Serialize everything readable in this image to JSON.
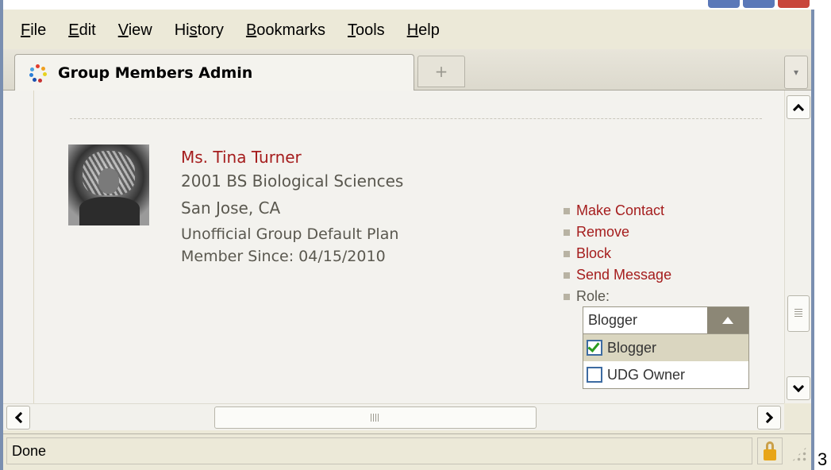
{
  "menubar": {
    "items": [
      {
        "name": "file",
        "prefix": "",
        "accel": "F",
        "rest": "ile"
      },
      {
        "name": "edit",
        "prefix": "",
        "accel": "E",
        "rest": "dit"
      },
      {
        "name": "view",
        "prefix": "",
        "accel": "V",
        "rest": "iew"
      },
      {
        "name": "history",
        "prefix": "Hi",
        "accel": "s",
        "rest": "tory"
      },
      {
        "name": "bookmarks",
        "prefix": "",
        "accel": "B",
        "rest": "ookmarks"
      },
      {
        "name": "tools",
        "prefix": "",
        "accel": "T",
        "rest": "ools"
      },
      {
        "name": "help",
        "prefix": "",
        "accel": "H",
        "rest": "elp"
      }
    ]
  },
  "tabs": {
    "active_title": "Group Members Admin",
    "new_tab_glyph": "+",
    "tab_list_glyph": "▾"
  },
  "member": {
    "name": "Ms. Tina Turner",
    "degree": "2001 BS Biological Sciences",
    "location": "San Jose, CA",
    "plan": "Unofficial Group Default Plan",
    "member_since": "Member Since: 04/15/2010"
  },
  "actions": {
    "make_contact": "Make Contact",
    "remove": "Remove",
    "block": "Block",
    "send_message": "Send Message",
    "role_label": "Role:"
  },
  "role_select": {
    "current": "Blogger",
    "options": [
      {
        "label": "Blogger",
        "checked": true
      },
      {
        "label": "UDG Owner",
        "checked": false
      }
    ]
  },
  "status": {
    "text": "Done"
  },
  "outside_text": "3",
  "colors": {
    "link_red": "#a51d1d",
    "muted_text": "#5a584f",
    "select_arrow_bg": "#8c8776",
    "check_green": "#2a9b1f"
  }
}
